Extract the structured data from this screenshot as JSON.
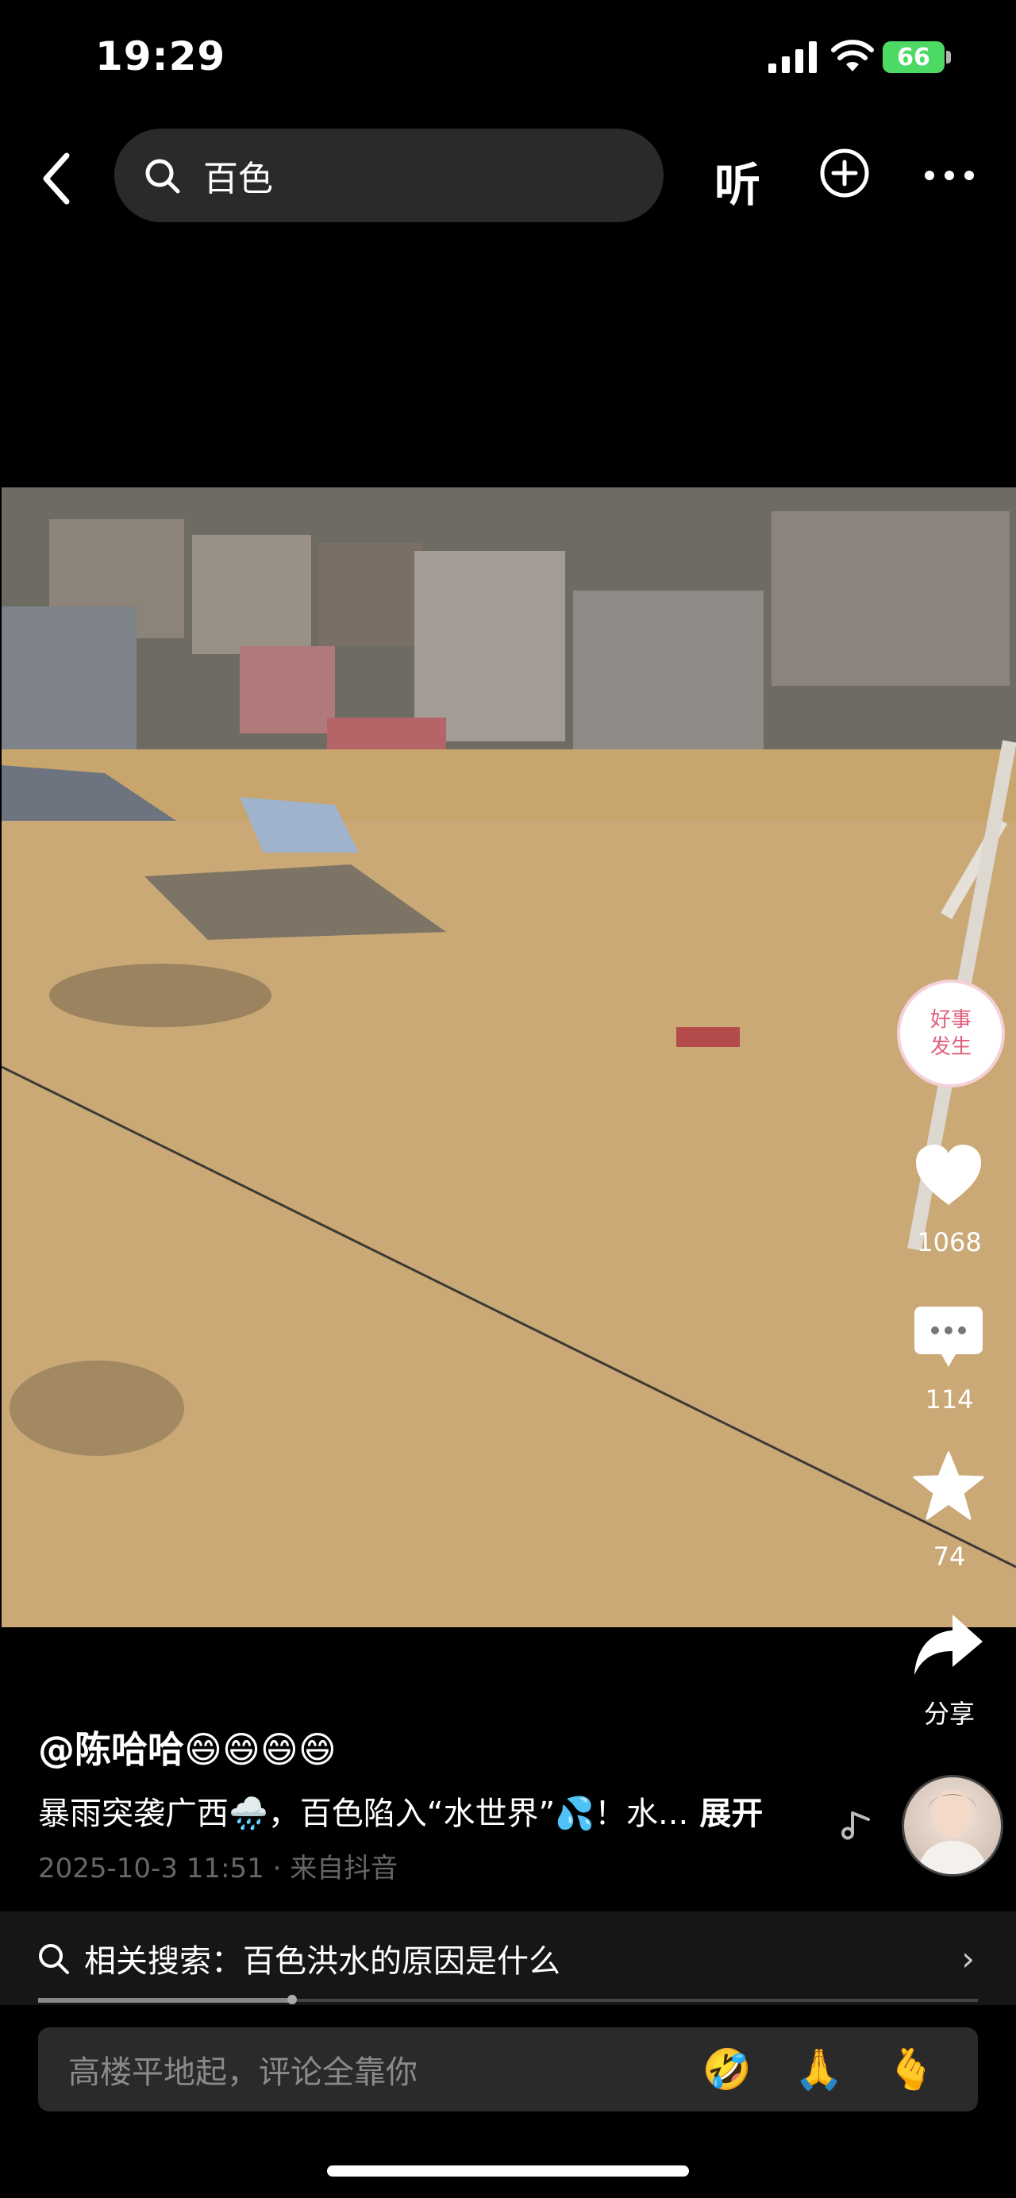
{
  "status_bar": {
    "time": "19:29",
    "battery": "66"
  },
  "header": {
    "search_query": "百色",
    "listen_label": "听"
  },
  "video": {
    "badge_text_1": "好事",
    "badge_text_2": "发生"
  },
  "actions": {
    "likes": "1068",
    "comments": "114",
    "favorites": "74",
    "share_label": "分享"
  },
  "post": {
    "author": "@陈哈哈😄😄😄😄",
    "caption": "暴雨突袭广西🌧️，百色陷入“水世界”💦！水...",
    "expand_label": "展开",
    "date": "2025-10-3 11:51",
    "source": "来自抖音"
  },
  "related_search": {
    "text": "相关搜索：百色洪水的原因是什么"
  },
  "progress": {
    "fraction": 0.27
  },
  "comment_bar": {
    "placeholder": "高楼平地起，评论全靠你",
    "emojis": [
      "🤣",
      "🙏",
      "🫰"
    ]
  },
  "colors": {
    "battery": "#4cd964",
    "background": "#000000",
    "badge_text": "#e0607a"
  }
}
